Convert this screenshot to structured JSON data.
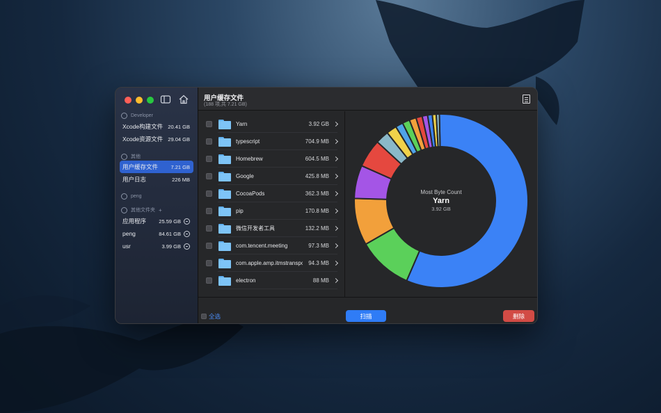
{
  "sidebar": {
    "sections": [
      {
        "label": "Developer"
      },
      {
        "label": "其他"
      },
      {
        "label": "peng"
      },
      {
        "label": "其他文件夹"
      }
    ],
    "items": [
      {
        "label": "Xcode构建文件",
        "size": "20.41 GB"
      },
      {
        "label": "Xcode资源文件",
        "size": "29.04 GB"
      },
      {
        "label": "用户缓存文件",
        "size": "7.21 GB"
      },
      {
        "label": "用户日志",
        "size": "226 MB"
      },
      {
        "label": "应用程序",
        "size": "25.59 GB"
      },
      {
        "label": "peng",
        "size": "84.61 GB"
      },
      {
        "label": "usr",
        "size": "3.99 GB"
      }
    ]
  },
  "header": {
    "title": "用户缓存文件",
    "subtitle": "(188 项,共 7.21 GB)"
  },
  "list": [
    {
      "name": "Yarn",
      "size": "3.92 GB"
    },
    {
      "name": "typescript",
      "size": "704.9 MB"
    },
    {
      "name": "Homebrew",
      "size": "604.5 MB"
    },
    {
      "name": "Google",
      "size": "425.8 MB"
    },
    {
      "name": "CocoaPods",
      "size": "362.3 MB"
    },
    {
      "name": "pip",
      "size": "170.8 MB"
    },
    {
      "name": "微信开发者工具",
      "size": "132.2 MB"
    },
    {
      "name": "com.tencent.meeting",
      "size": "97.3 MB"
    },
    {
      "name": "com.apple.amp.itmstransporter",
      "size": "94.3 MB"
    },
    {
      "name": "electron",
      "size": "88 MB"
    }
  ],
  "chart_data": {
    "type": "pie",
    "center_label": "Most Byte Count",
    "center_name": "Yarn",
    "center_value": "3.92 GB",
    "slices": [
      {
        "value": 3920,
        "color": "#3b82f6"
      },
      {
        "value": 704.9,
        "color": "#5bd05a"
      },
      {
        "value": 604.5,
        "color": "#f2a03b"
      },
      {
        "value": 425.8,
        "color": "#a455e6"
      },
      {
        "value": 362.3,
        "color": "#e5483f"
      },
      {
        "value": 170.8,
        "color": "#8ab8c9"
      },
      {
        "value": 132.2,
        "color": "#f0d24a"
      },
      {
        "value": 97.3,
        "color": "#4fa3e8"
      },
      {
        "value": 94.3,
        "color": "#5bd05a"
      },
      {
        "value": 88,
        "color": "#f2a03b"
      },
      {
        "value": 80,
        "color": "#e5483f"
      },
      {
        "value": 70,
        "color": "#a455e6"
      },
      {
        "value": 60,
        "color": "#3b82f6"
      },
      {
        "value": 50,
        "color": "#f0d24a"
      },
      {
        "value": 40,
        "color": "#8ab8c9"
      }
    ]
  },
  "footer": {
    "select_all": "全选",
    "scan": "扫描",
    "delete": "删除"
  }
}
